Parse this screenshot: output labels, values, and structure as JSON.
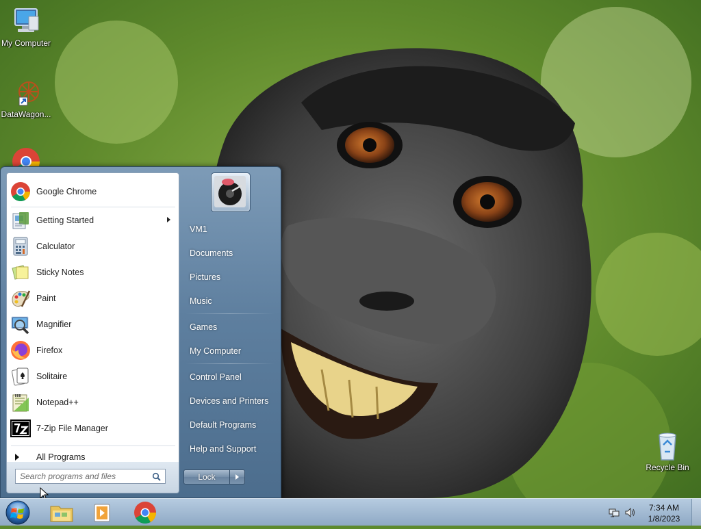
{
  "desktop": {
    "icons": [
      {
        "label": "My Computer",
        "icon": "computer-icon"
      },
      {
        "label": "DataWagon...",
        "icon": "datawagon-shortcut-icon"
      },
      {
        "label": "",
        "icon": "google-chrome-icon"
      },
      {
        "label": "Recycle Bin",
        "icon": "recycle-bin-icon"
      }
    ]
  },
  "start_menu": {
    "programs": [
      {
        "label": "Google Chrome",
        "icon": "google-chrome-icon"
      },
      {
        "label": "Getting Started",
        "icon": "getting-started-icon",
        "has_submenu": true
      },
      {
        "label": "Calculator",
        "icon": "calculator-icon"
      },
      {
        "label": "Sticky Notes",
        "icon": "sticky-notes-icon"
      },
      {
        "label": "Paint",
        "icon": "paint-icon"
      },
      {
        "label": "Magnifier",
        "icon": "magnifier-icon"
      },
      {
        "label": "Firefox",
        "icon": "firefox-icon"
      },
      {
        "label": "Solitaire",
        "icon": "solitaire-icon"
      },
      {
        "label": "Notepad++",
        "icon": "notepad-plus-plus-icon"
      },
      {
        "label": "7-Zip File Manager",
        "icon": "seven-zip-icon"
      }
    ],
    "all_programs": "All Programs",
    "search_placeholder": "Search programs and files",
    "right_items": [
      {
        "label": "VM1"
      },
      {
        "label": "Documents"
      },
      {
        "label": "Pictures"
      },
      {
        "label": "Music"
      },
      {
        "label": "Games"
      },
      {
        "label": "My Computer"
      },
      {
        "label": "Control Panel"
      },
      {
        "label": "Devices and Printers"
      },
      {
        "label": "Default Programs"
      },
      {
        "label": "Help and Support"
      }
    ],
    "lock_label": "Lock"
  },
  "taskbar": {
    "pinned": [
      {
        "icon": "windows-explorer-icon"
      },
      {
        "icon": "media-player-icon"
      },
      {
        "icon": "google-chrome-icon"
      }
    ],
    "clock": {
      "time": "7:34 AM",
      "date": "1/8/2023"
    },
    "tray_icons": [
      "network-icon",
      "volume-icon"
    ]
  },
  "colors": {
    "start_menu_accent": "#5e7f9f",
    "taskbar": "#a3bad3"
  }
}
